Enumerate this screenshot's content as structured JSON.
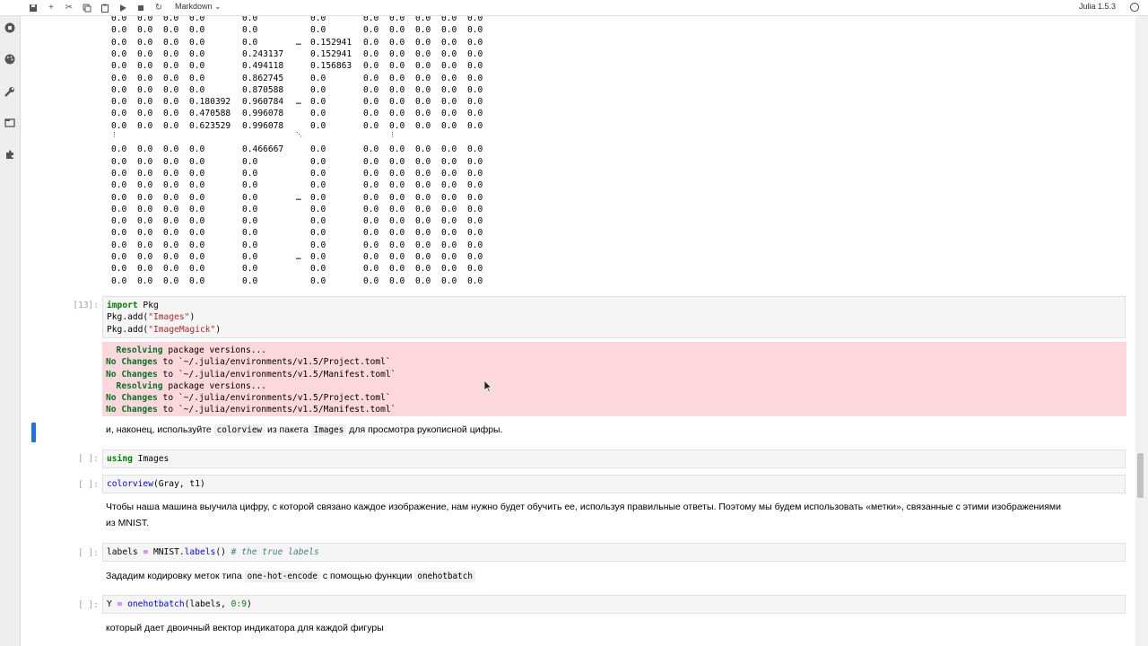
{
  "toolbar": {
    "cell_type": "Markdown",
    "kernel_name": "Julia 1.5.3",
    "icons": [
      "save-icon",
      "add-cell-icon",
      "cut-icon",
      "copy-icon",
      "paste-icon",
      "run-icon",
      "stop-icon",
      "restart-icon",
      "chevron-down-icon"
    ]
  },
  "sidebar": {
    "icons": [
      "running-icon",
      "palette-icon",
      "wrench-icon",
      "tabs-icon",
      "extension-icon"
    ]
  },
  "matrix_output": {
    "rows": [
      [
        "0.0",
        "0.0",
        "0.0",
        "0.0",
        "0.0",
        "",
        "0.0",
        "0.0",
        "0.0",
        "0.0",
        "0.0",
        "0.0"
      ],
      [
        "0.0",
        "0.0",
        "0.0",
        "0.0",
        "0.0",
        "",
        "0.0",
        "0.0",
        "0.0",
        "0.0",
        "0.0",
        "0.0"
      ],
      [
        "0.0",
        "0.0",
        "0.0",
        "0.0",
        "0.0",
        "…",
        "0.152941",
        "0.0",
        "0.0",
        "0.0",
        "0.0",
        "0.0"
      ],
      [
        "0.0",
        "0.0",
        "0.0",
        "0.0",
        "0.243137",
        "",
        "0.152941",
        "0.0",
        "0.0",
        "0.0",
        "0.0",
        "0.0"
      ],
      [
        "0.0",
        "0.0",
        "0.0",
        "0.0",
        "0.494118",
        "",
        "0.156863",
        "0.0",
        "0.0",
        "0.0",
        "0.0",
        "0.0"
      ],
      [
        "0.0",
        "0.0",
        "0.0",
        "0.0",
        "0.862745",
        "",
        "0.0",
        "0.0",
        "0.0",
        "0.0",
        "0.0",
        "0.0"
      ],
      [
        "0.0",
        "0.0",
        "0.0",
        "0.0",
        "0.870588",
        "",
        "0.0",
        "0.0",
        "0.0",
        "0.0",
        "0.0",
        "0.0"
      ],
      [
        "0.0",
        "0.0",
        "0.0",
        "0.180392",
        "0.960784",
        "…",
        "0.0",
        "0.0",
        "0.0",
        "0.0",
        "0.0",
        "0.0"
      ],
      [
        "0.0",
        "0.0",
        "0.0",
        "0.470588",
        "0.996078",
        "",
        "0.0",
        "0.0",
        "0.0",
        "0.0",
        "0.0",
        "0.0"
      ],
      [
        "0.0",
        "0.0",
        "0.0",
        "0.623529",
        "0.996078",
        "",
        "0.0",
        "0.0",
        "0.0",
        "0.0",
        "0.0",
        "0.0"
      ],
      [
        "⋮",
        "",
        "",
        "",
        "",
        "⋱",
        "",
        "",
        "⋮",
        "",
        "",
        ""
      ],
      [
        "0.0",
        "0.0",
        "0.0",
        "0.0",
        "0.466667",
        "",
        "0.0",
        "0.0",
        "0.0",
        "0.0",
        "0.0",
        "0.0"
      ],
      [
        "0.0",
        "0.0",
        "0.0",
        "0.0",
        "0.0",
        "",
        "0.0",
        "0.0",
        "0.0",
        "0.0",
        "0.0",
        "0.0"
      ],
      [
        "0.0",
        "0.0",
        "0.0",
        "0.0",
        "0.0",
        "",
        "0.0",
        "0.0",
        "0.0",
        "0.0",
        "0.0",
        "0.0"
      ],
      [
        "0.0",
        "0.0",
        "0.0",
        "0.0",
        "0.0",
        "",
        "0.0",
        "0.0",
        "0.0",
        "0.0",
        "0.0",
        "0.0"
      ],
      [
        "0.0",
        "0.0",
        "0.0",
        "0.0",
        "0.0",
        "…",
        "0.0",
        "0.0",
        "0.0",
        "0.0",
        "0.0",
        "0.0"
      ],
      [
        "0.0",
        "0.0",
        "0.0",
        "0.0",
        "0.0",
        "",
        "0.0",
        "0.0",
        "0.0",
        "0.0",
        "0.0",
        "0.0"
      ],
      [
        "0.0",
        "0.0",
        "0.0",
        "0.0",
        "0.0",
        "",
        "0.0",
        "0.0",
        "0.0",
        "0.0",
        "0.0",
        "0.0"
      ],
      [
        "0.0",
        "0.0",
        "0.0",
        "0.0",
        "0.0",
        "",
        "0.0",
        "0.0",
        "0.0",
        "0.0",
        "0.0",
        "0.0"
      ],
      [
        "0.0",
        "0.0",
        "0.0",
        "0.0",
        "0.0",
        "",
        "0.0",
        "0.0",
        "0.0",
        "0.0",
        "0.0",
        "0.0"
      ],
      [
        "0.0",
        "0.0",
        "0.0",
        "0.0",
        "0.0",
        "…",
        "0.0",
        "0.0",
        "0.0",
        "0.0",
        "0.0",
        "0.0"
      ],
      [
        "0.0",
        "0.0",
        "0.0",
        "0.0",
        "0.0",
        "",
        "0.0",
        "0.0",
        "0.0",
        "0.0",
        "0.0",
        "0.0"
      ],
      [
        "0.0",
        "0.0",
        "0.0",
        "0.0",
        "0.0",
        "",
        "0.0",
        "0.0",
        "0.0",
        "0.0",
        "0.0",
        "0.0"
      ]
    ]
  },
  "cells": {
    "c13": {
      "prompt": "[13]:",
      "line1_kw": "import",
      "line1_rest": " Pkg",
      "line2_pre": "Pkg.add(",
      "line2_str": "\"Images\"",
      "line2_post": ")",
      "line3_pre": "Pkg.add(",
      "line3_str": "\"ImageMagick\"",
      "line3_post": ")"
    },
    "c13_output": {
      "l1_a": "  Resolving",
      "l1_b": " package versions...",
      "l2_a": "No Changes",
      "l2_b": " to `~/.julia/environments/v1.5/Project.toml`",
      "l3_a": "No Changes",
      "l3_b": " to `~/.julia/environments/v1.5/Manifest.toml`",
      "l4_a": "  Resolving",
      "l4_b": " package versions...",
      "l5_a": "No Changes",
      "l5_b": " to `~/.julia/environments/v1.5/Project.toml`",
      "l6_a": "No Changes",
      "l6_b": " to `~/.julia/environments/v1.5/Manifest.toml`"
    },
    "md1": {
      "t1": "и, наконец, используйте ",
      "code1": "colorview",
      "t2": " из пакета ",
      "code2": "Images",
      "t3": " для просмотра рукописной цифры."
    },
    "c_using": {
      "prompt": "[ ]:",
      "kw": "using",
      "rest": " Images"
    },
    "c_colorview": {
      "prompt": "[ ]:",
      "fn": "colorview",
      "rest": "(Gray, t1)"
    },
    "md2": {
      "text": "Чтобы наша машина выучила цифру, с которой связано каждое изображение, нам нужно будет обучить ее, используя правильные ответы. Поэтому мы будем использовать «метки», связанные с этими изображениями из MNIST."
    },
    "c_labels": {
      "prompt": "[ ]:",
      "var": "labels ",
      "op": "=",
      "call": " MNIST.",
      "fn": "labels",
      "args": "() ",
      "comment": "# the true labels"
    },
    "md3": {
      "t1": "Зададим кодировку меток типа ",
      "code1": "one-hot-encode",
      "t2": " с помощью функции ",
      "code2": "onehotbatch"
    },
    "c_onehot": {
      "prompt": "[ ]:",
      "var": "Y ",
      "op": "=",
      "sp": " ",
      "fn": "onehotbatch",
      "a1": "(labels, ",
      "n1": "0",
      "colon": ":",
      "n2": "9",
      "a2": ")"
    },
    "md4": {
      "text": "который дает двоичный вектор индикатора для каждой фигуры"
    }
  }
}
